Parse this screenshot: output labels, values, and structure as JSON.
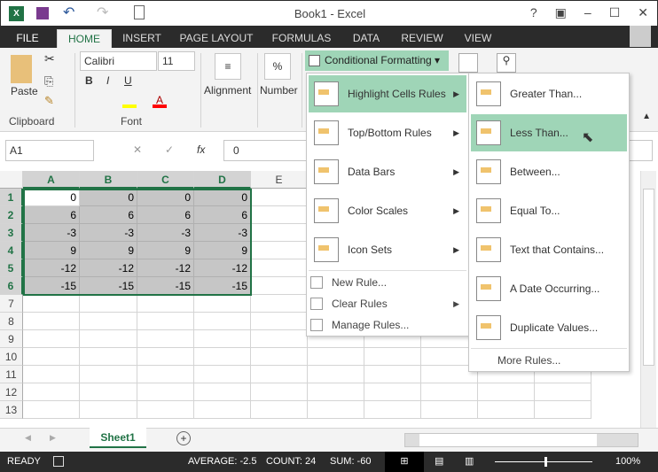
{
  "title": "Book1 - Excel",
  "title_buttons": [
    "?",
    "▣",
    "–",
    "☐",
    "✕"
  ],
  "tabs": [
    "FILE",
    "HOME",
    "INSERT",
    "PAGE LAYOUT",
    "FORMULAS",
    "DATA",
    "REVIEW",
    "VIEW"
  ],
  "ribbon": {
    "paste": "Paste",
    "clipboard": "Clipboard",
    "font_name": "Calibri",
    "font_size": "11",
    "bold": "B",
    "italic": "I",
    "underline": "U",
    "font": "Font",
    "alignment": "Alignment",
    "number": "Number",
    "percent": "%",
    "cond_fmt": "Conditional Formatting ▾"
  },
  "formula": {
    "namebox": "A1",
    "fx": "fx",
    "value": "0"
  },
  "columns": [
    "A",
    "B",
    "C",
    "D",
    "E"
  ],
  "rows": [
    "1",
    "2",
    "3",
    "4",
    "5",
    "6",
    "7",
    "8",
    "9",
    "10",
    "11",
    "12",
    "13"
  ],
  "cells": [
    [
      "0",
      "0",
      "0",
      "0"
    ],
    [
      "6",
      "6",
      "6",
      "6"
    ],
    [
      "-3",
      "-3",
      "-3",
      "-3"
    ],
    [
      "9",
      "9",
      "9",
      "9"
    ],
    [
      "-12",
      "-12",
      "-12",
      "-12"
    ],
    [
      "-15",
      "-15",
      "-15",
      "-15"
    ]
  ],
  "menu": {
    "items": [
      "Highlight Cells Rules",
      "Top/Bottom Rules",
      "Data Bars",
      "Color Scales",
      "Icon Sets"
    ],
    "small": [
      "New Rule...",
      "Clear Rules",
      "Manage Rules..."
    ]
  },
  "submenu": {
    "items": [
      "Greater Than...",
      "Less Than...",
      "Between...",
      "Equal To...",
      "Text that Contains...",
      "A Date Occurring...",
      "Duplicate Values..."
    ],
    "more": "More Rules..."
  },
  "sheet": {
    "tab": "Sheet1"
  },
  "status": {
    "ready": "READY",
    "average": "AVERAGE: -2.5",
    "count": "COUNT: 24",
    "sum": "SUM: -60",
    "zoom": "100%"
  },
  "colors": {
    "accent": "#217346",
    "menu_highlight": "#9fd5b7"
  }
}
